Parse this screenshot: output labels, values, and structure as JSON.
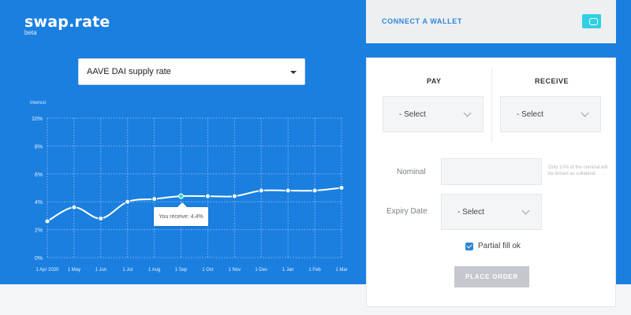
{
  "app": {
    "name": "swap.rate",
    "tag": "beta"
  },
  "rate_selector": {
    "value": "AAVE DAI supply rate"
  },
  "tooltip": {
    "text": "You receive: 4.4%"
  },
  "wallet": {
    "label": "CONNECT A WALLET"
  },
  "order": {
    "pay_label": "PAY",
    "receive_label": "RECEIVE",
    "pay_select": "- Select",
    "receive_select": "- Select",
    "nominal_label": "Nominal",
    "nominal_value": "",
    "nominal_note": "Only 10% of the nominal will be locked as collateral.",
    "expiry_label": "Expiry Date",
    "expiry_select": "- Select",
    "partial_fill_label": "Partial fill ok",
    "partial_fill_checked": true,
    "place_order_label": "PLACE ORDER"
  },
  "colors": {
    "hero_bg": "#1b7fe0",
    "accent": "#2d86da",
    "highlight_point": "#2fe0c0"
  },
  "chart_data": {
    "type": "line",
    "ylabel": "Interest",
    "ylim": [
      0,
      10
    ],
    "yticks": [
      "0%",
      "2%",
      "4%",
      "6%",
      "8%",
      "10%"
    ],
    "categories": [
      "1 Apr 2020",
      "1 May",
      "1 Jun",
      "1 Jul",
      "1 Aug",
      "1 Sep",
      "1 Oct",
      "1 Nov",
      "1 Dec",
      "1 Jan",
      "1 Feb",
      "1 Mar"
    ],
    "series": [
      {
        "values": [
          2.6,
          3.6,
          2.8,
          4.0,
          4.2,
          4.4,
          4.4,
          4.4,
          4.8,
          4.8,
          4.8,
          5.0
        ]
      }
    ],
    "highlight_index": 5,
    "grid": true
  }
}
